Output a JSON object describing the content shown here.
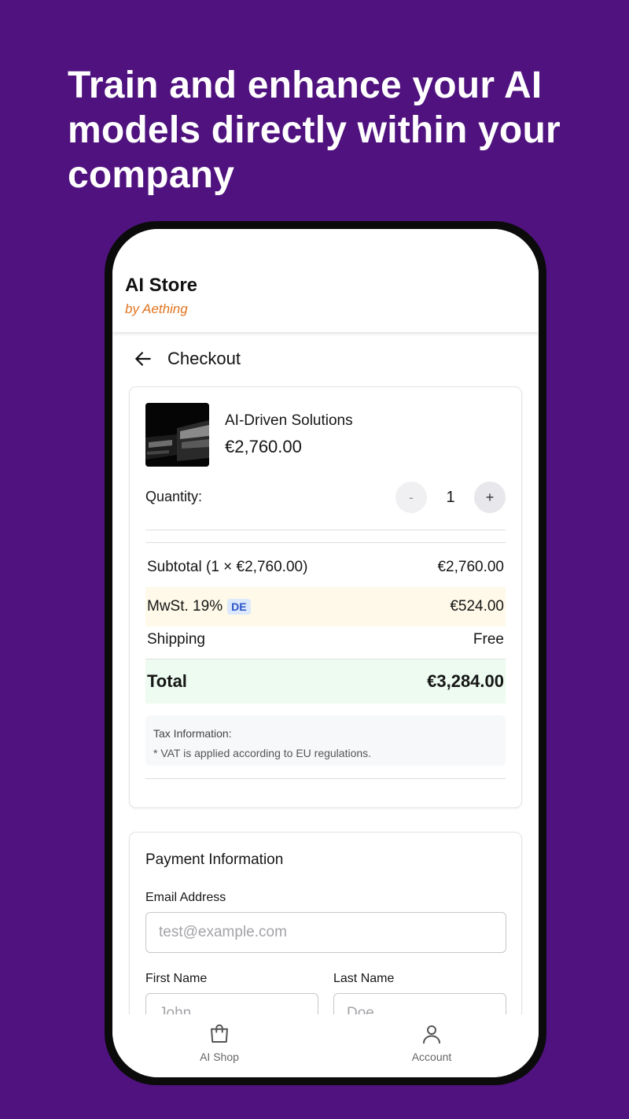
{
  "promo": {
    "headline": "Train and enhance your AI models directly within your company"
  },
  "app": {
    "title": "AI Store",
    "subtitle": "by Aething",
    "accent_color": "#e0731f",
    "background_color": "#4f127e"
  },
  "checkout": {
    "back_icon": "arrow-left-icon",
    "title": "Checkout"
  },
  "product": {
    "name": "AI-Driven Solutions",
    "price": "€2,760.00"
  },
  "quantity": {
    "label": "Quantity:",
    "minus_label": "-",
    "value": "1",
    "plus_label": "+"
  },
  "summary": {
    "subtotal_label": "Subtotal (1 × €2,760.00)",
    "subtotal_value": "€2,760.00",
    "tax_label": "MwSt. 19%",
    "tax_country_badge": "DE",
    "tax_value": "€524.00",
    "shipping_label": "Shipping",
    "shipping_value": "Free",
    "total_label": "Total",
    "total_value": "€3,284.00"
  },
  "tax_info": {
    "title": "Tax Information:",
    "note": "* VAT is applied according to EU regulations."
  },
  "payment": {
    "title": "Payment Information",
    "email_label": "Email Address",
    "email_placeholder": "test@example.com",
    "first_name_label": "First Name",
    "first_name_placeholder": "John",
    "last_name_label": "Last Name",
    "last_name_placeholder": "Doe"
  },
  "tabbar": {
    "items": [
      {
        "label": "AI Shop",
        "icon": "shopping-bag-icon"
      },
      {
        "label": "Account",
        "icon": "user-icon"
      }
    ]
  }
}
